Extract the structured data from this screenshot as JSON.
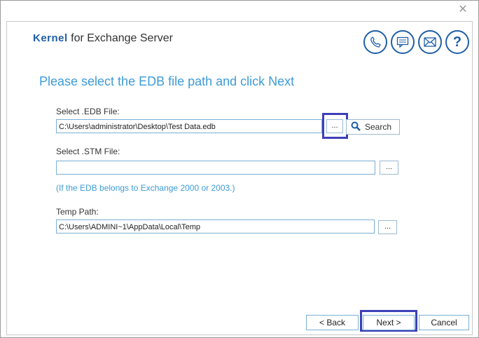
{
  "window": {
    "close_glyph": "✕"
  },
  "header": {
    "brand": "Kernel",
    "product": "for Exchange Server",
    "icons": [
      "phone-icon",
      "chat-icon",
      "mail-icon",
      "help-icon"
    ]
  },
  "page": {
    "heading": "Please select the EDB file path and click Next"
  },
  "edb": {
    "label": "Select .EDB File:",
    "value": "C:\\Users\\administrator\\Desktop\\Test Data.edb",
    "browse_label": "...",
    "search_label": "Search"
  },
  "stm": {
    "label": "Select .STM File:",
    "value": "",
    "browse_label": "...",
    "note": "(If the EDB belongs to Exchange 2000 or 2003.)"
  },
  "temp": {
    "label": "Temp Path:",
    "value": "C:\\Users\\ADMINI~1\\AppData\\Local\\Temp",
    "browse_label": "..."
  },
  "footer": {
    "back_label": "< Back",
    "next_label": "Next >",
    "cancel_label": "Cancel"
  },
  "colors": {
    "accent": "#3d9bd6",
    "brand": "#1f5fa8",
    "highlight": "#3d3fb8"
  }
}
